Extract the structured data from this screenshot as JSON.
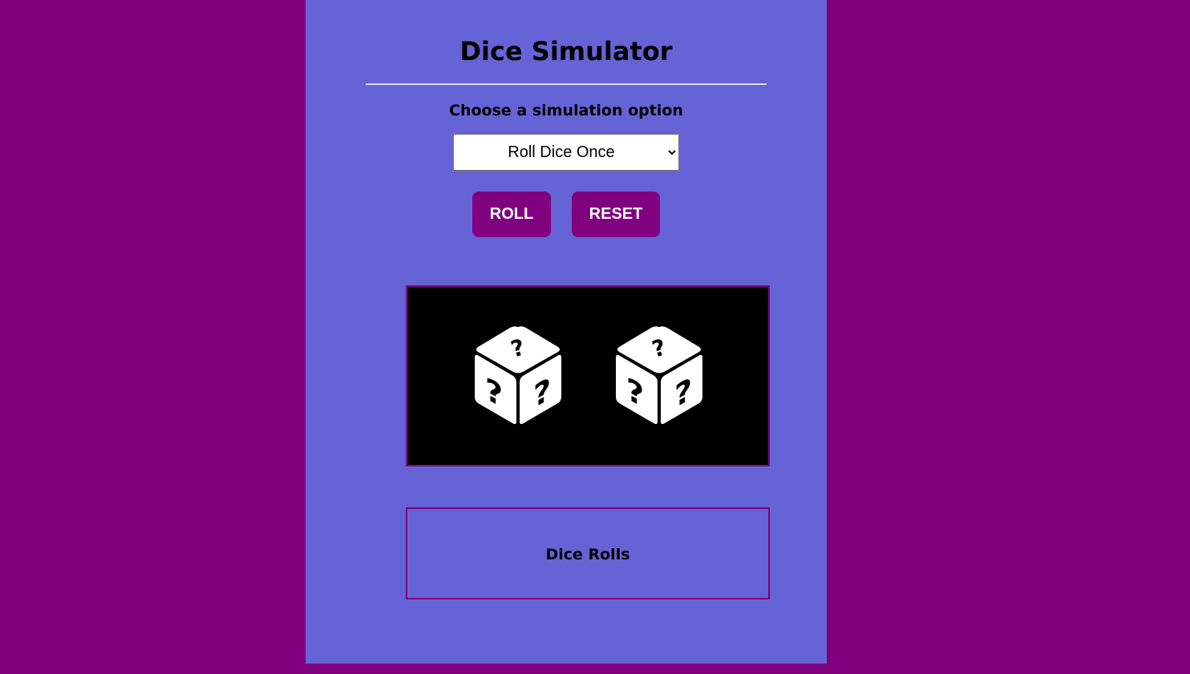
{
  "page": {
    "title": "Dice Simulator",
    "subtitle": "Choose a simulation option"
  },
  "select": {
    "selected": "Roll Dice Once"
  },
  "buttons": {
    "roll_label": "ROLL",
    "reset_label": "RESET"
  },
  "dice": {
    "count": 2,
    "icon": "question-dice-icon",
    "face_symbol": "?"
  },
  "rolls": {
    "title": "Dice Rolls"
  },
  "colors": {
    "page_background": "#800080",
    "panel_background": "#6563d5",
    "accent": "#800080",
    "dice_box_background": "#000000",
    "dice_color": "#ffffff"
  }
}
